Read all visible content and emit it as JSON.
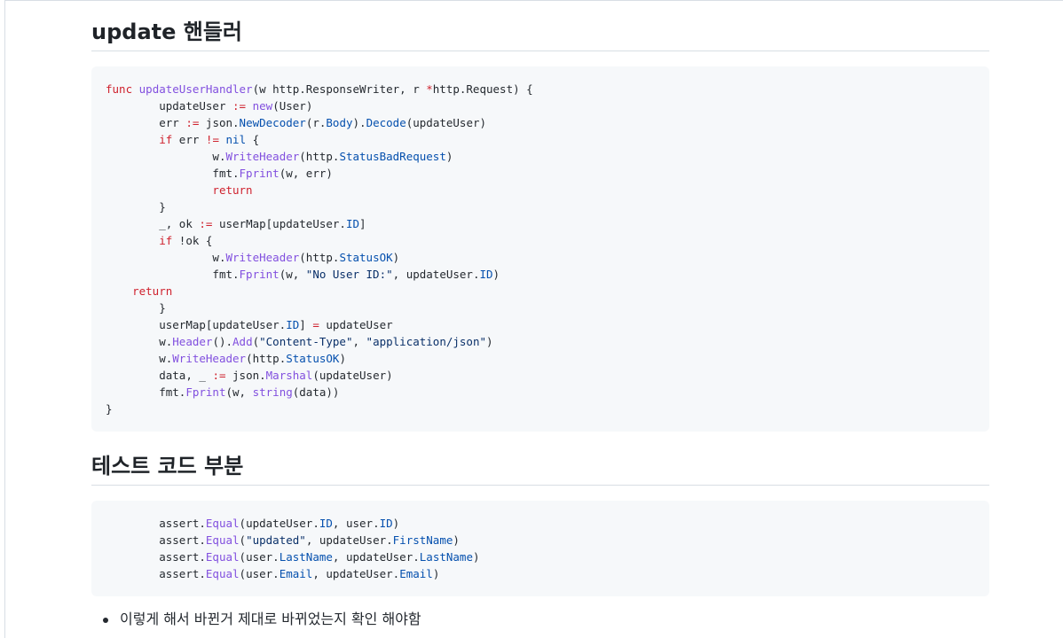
{
  "section1": {
    "heading": "update 핸들러"
  },
  "code1": {
    "lines": [
      [
        [
          "kw",
          "func"
        ],
        [
          "t",
          " "
        ],
        [
          "fn",
          "updateUserHandler"
        ],
        [
          "t",
          "(w http.ResponseWriter, r "
        ],
        [
          "kw",
          "*"
        ],
        [
          "t",
          "http.Request) {"
        ]
      ],
      [
        [
          "t",
          "\t"
        ],
        [
          "t",
          "updateUser "
        ],
        [
          "kw",
          ":="
        ],
        [
          "t",
          " "
        ],
        [
          "fn",
          "new"
        ],
        [
          "t",
          "(User)"
        ]
      ],
      [
        [
          "t",
          "\terr "
        ],
        [
          "kw",
          ":="
        ],
        [
          "t",
          " json."
        ],
        [
          "pr",
          "NewDecoder"
        ],
        [
          "t",
          "(r."
        ],
        [
          "pr",
          "Body"
        ],
        [
          "t",
          ")."
        ],
        [
          "pr",
          "Decode"
        ],
        [
          "t",
          "(updateUser)"
        ]
      ],
      [
        [
          "t",
          "\t"
        ],
        [
          "kw",
          "if"
        ],
        [
          "t",
          " err "
        ],
        [
          "kw",
          "!="
        ],
        [
          "t",
          " "
        ],
        [
          "pr",
          "nil"
        ],
        [
          "t",
          " {"
        ]
      ],
      [
        [
          "t",
          "\t\tw."
        ],
        [
          "fn",
          "WriteHeader"
        ],
        [
          "t",
          "(http."
        ],
        [
          "pr",
          "StatusBadRequest"
        ],
        [
          "t",
          ")"
        ]
      ],
      [
        [
          "t",
          "\t\tfmt."
        ],
        [
          "fn",
          "Fprint"
        ],
        [
          "t",
          "(w, err)"
        ]
      ],
      [
        [
          "t",
          "\t\t"
        ],
        [
          "kw",
          "return"
        ]
      ],
      [
        [
          "t",
          "\t}"
        ]
      ],
      [
        [
          "t",
          "\t_, ok "
        ],
        [
          "kw",
          ":="
        ],
        [
          "t",
          " userMap[updateUser."
        ],
        [
          "pr",
          "ID"
        ],
        [
          "t",
          "]"
        ]
      ],
      [
        [
          "t",
          "\t"
        ],
        [
          "kw",
          "if"
        ],
        [
          "t",
          " !ok {"
        ]
      ],
      [
        [
          "t",
          "\t\tw."
        ],
        [
          "fn",
          "WriteHeader"
        ],
        [
          "t",
          "(http."
        ],
        [
          "pr",
          "StatusOK"
        ],
        [
          "t",
          ")"
        ]
      ],
      [
        [
          "t",
          "\t\tfmt."
        ],
        [
          "fn",
          "Fprint"
        ],
        [
          "t",
          "(w, "
        ],
        [
          "st",
          "\"No User ID:\""
        ],
        [
          "t",
          ", updateUser."
        ],
        [
          "pr",
          "ID"
        ],
        [
          "t",
          ")"
        ]
      ],
      [
        [
          "t",
          "    "
        ],
        [
          "kw",
          "return"
        ]
      ],
      [
        [
          "t",
          "\t}"
        ]
      ],
      [
        [
          "t",
          "\tuserMap[updateUser."
        ],
        [
          "pr",
          "ID"
        ],
        [
          "t",
          "] "
        ],
        [
          "kw",
          "="
        ],
        [
          "t",
          " updateUser"
        ]
      ],
      [
        [
          "t",
          "\tw."
        ],
        [
          "fn",
          "Header"
        ],
        [
          "t",
          "()."
        ],
        [
          "fn",
          "Add"
        ],
        [
          "t",
          "("
        ],
        [
          "st",
          "\"Content-Type\""
        ],
        [
          "t",
          ", "
        ],
        [
          "st",
          "\"application/json\""
        ],
        [
          "t",
          ")"
        ]
      ],
      [
        [
          "t",
          "\tw."
        ],
        [
          "fn",
          "WriteHeader"
        ],
        [
          "t",
          "(http."
        ],
        [
          "pr",
          "StatusOK"
        ],
        [
          "t",
          ")"
        ]
      ],
      [
        [
          "t",
          "\tdata, _ "
        ],
        [
          "kw",
          ":="
        ],
        [
          "t",
          " json."
        ],
        [
          "fn",
          "Marshal"
        ],
        [
          "t",
          "(updateUser)"
        ]
      ],
      [
        [
          "t",
          "\tfmt."
        ],
        [
          "fn",
          "Fprint"
        ],
        [
          "t",
          "(w, "
        ],
        [
          "fn",
          "string"
        ],
        [
          "t",
          "(data))"
        ]
      ],
      [
        [
          "t",
          "}"
        ]
      ]
    ]
  },
  "section2": {
    "heading": "테스트 코드 부분"
  },
  "code2": {
    "lines": [
      [
        [
          "t",
          "\tassert."
        ],
        [
          "fn",
          "Equal"
        ],
        [
          "t",
          "(updateUser."
        ],
        [
          "pr",
          "ID"
        ],
        [
          "t",
          ", user."
        ],
        [
          "pr",
          "ID"
        ],
        [
          "t",
          ")"
        ]
      ],
      [
        [
          "t",
          "\tassert."
        ],
        [
          "fn",
          "Equal"
        ],
        [
          "t",
          "("
        ],
        [
          "st",
          "\"updated\""
        ],
        [
          "t",
          ", updateUser."
        ],
        [
          "pr",
          "FirstName"
        ],
        [
          "t",
          ")"
        ]
      ],
      [
        [
          "t",
          "\tassert."
        ],
        [
          "fn",
          "Equal"
        ],
        [
          "t",
          "(user."
        ],
        [
          "pr",
          "LastName"
        ],
        [
          "t",
          ", updateUser."
        ],
        [
          "pr",
          "LastName"
        ],
        [
          "t",
          ")"
        ]
      ],
      [
        [
          "t",
          "\tassert."
        ],
        [
          "fn",
          "Equal"
        ],
        [
          "t",
          "(user."
        ],
        [
          "pr",
          "Email"
        ],
        [
          "t",
          ", updateUser."
        ],
        [
          "pr",
          "Email"
        ],
        [
          "t",
          ")"
        ]
      ]
    ]
  },
  "bullets": [
    "이렇게 해서 바뀐거 제대로 바뀌었는지 확인 해야함"
  ],
  "colors": {
    "keyword": "#cf222e",
    "function": "#8250df",
    "property": "#0550ae",
    "string": "#0a3069",
    "code_bg": "#f6f8fa"
  }
}
